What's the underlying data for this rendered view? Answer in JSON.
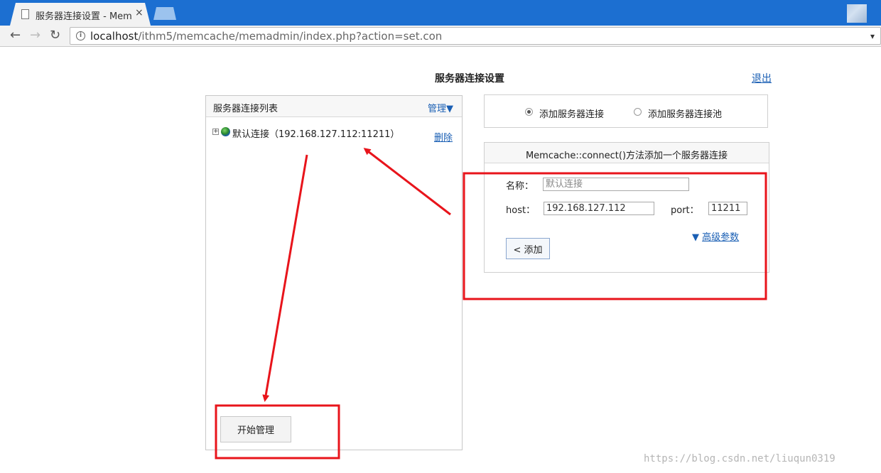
{
  "browser": {
    "tab_title": "服务器连接设置 - MemA",
    "tab_close": "×",
    "url_host": "localhost",
    "url_path": "/ithm5/memcache/memadmin/index.php?action=set.con"
  },
  "header": {
    "title": "服务器连接设置",
    "logout": "退出"
  },
  "server_list": {
    "title": "服务器连接列表",
    "manage": "管理▼",
    "items": [
      {
        "toggle": "+",
        "label": "默认连接（192.168.127.112:11211）",
        "delete": "删除"
      }
    ],
    "start_button": "开始管理"
  },
  "mode": {
    "options": [
      {
        "label": "添加服务器连接",
        "selected": true
      },
      {
        "label": "添加服务器连接池",
        "selected": false
      }
    ]
  },
  "form": {
    "title": "Memcache::connect()方法添加一个服务器连接",
    "name_label": "名称：",
    "name_placeholder": "默认连接",
    "host_label": "host：",
    "host_value": "192.168.127.112",
    "port_label": "port：",
    "port_value": "11211",
    "advanced_arrow": "▼",
    "advanced": "高级参数",
    "add_button": "< 添加"
  },
  "watermark": "https://blog.csdn.net/liuqun0319",
  "colors": {
    "annotation": "#e8141b",
    "link": "#1a5fb4",
    "titlebar": "#1c6fd1"
  }
}
